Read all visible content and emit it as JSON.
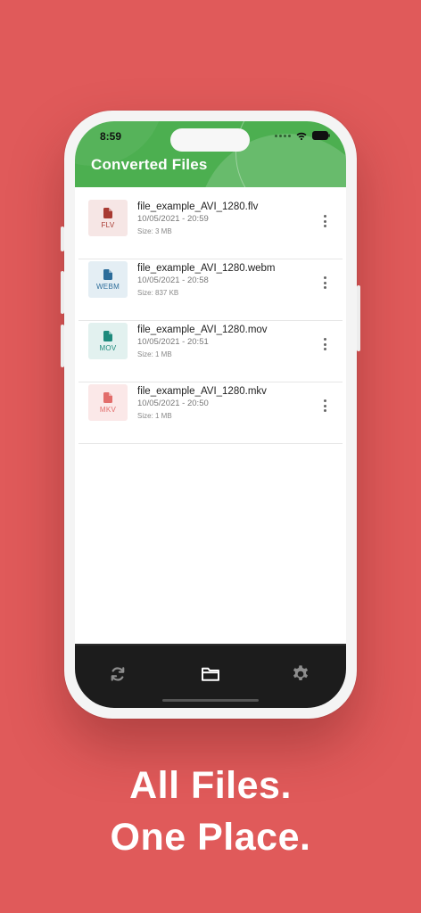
{
  "status_bar": {
    "time": "8:59"
  },
  "header": {
    "title": "Converted Files"
  },
  "files": [
    {
      "name": "file_example_AVI_1280.flv",
      "date": "10/05/2021 - 20:59",
      "size": "Size: 3 MB",
      "ext": "FLV",
      "color": "#a83a32",
      "bg": "#f6e6e5"
    },
    {
      "name": "file_example_AVI_1280.webm",
      "date": "10/05/2021 - 20:58",
      "size": "Size: 837 KB",
      "ext": "WEBM",
      "color": "#2d6d9a",
      "bg": "#e4eef4"
    },
    {
      "name": "file_example_AVI_1280.mov",
      "date": "10/05/2021 - 20:51",
      "size": "Size: 1 MB",
      "ext": "MOV",
      "color": "#1e8a7c",
      "bg": "#e2f1ef"
    },
    {
      "name": "file_example_AVI_1280.mkv",
      "date": "10/05/2021 - 20:50",
      "size": "Size: 1 MB",
      "ext": "MKV",
      "color": "#e26d6b",
      "bg": "#fbe8e8"
    }
  ],
  "tabbar": {
    "tabs": [
      {
        "icon": "refresh-icon",
        "color": "#8d8d8d"
      },
      {
        "icon": "folder-icon",
        "color": "#ffffff"
      },
      {
        "icon": "gear-icon",
        "color": "#8d8d8d"
      }
    ]
  },
  "tagline": {
    "line1": "All Files.",
    "line2": "One Place."
  },
  "colors": {
    "background": "#e05a5a",
    "header": "#4caf50",
    "tabbar": "#1c1c1c"
  }
}
